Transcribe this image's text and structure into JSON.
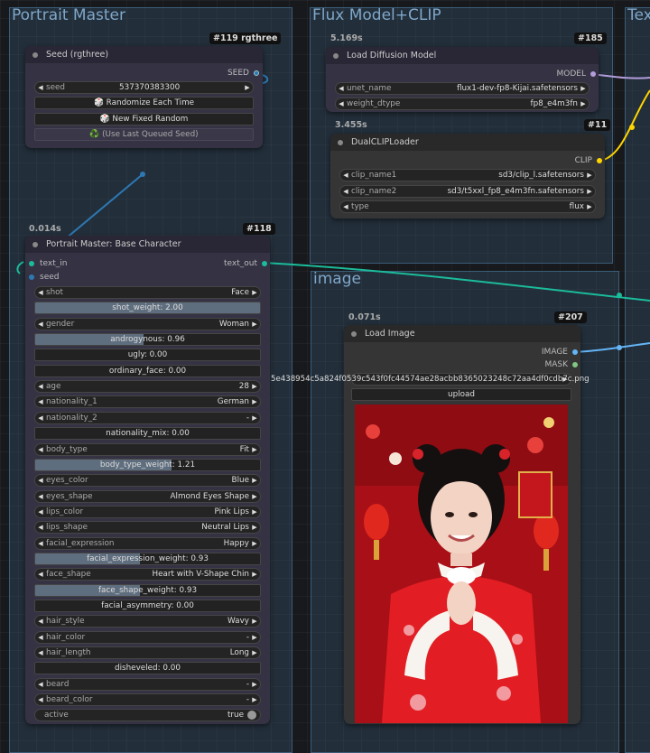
{
  "groups": {
    "portrait_master": "Portrait Master",
    "flux": "Flux Model+CLIP",
    "image": "image",
    "text_partial": "Tex"
  },
  "seed_node": {
    "badge": "#119 rgthree",
    "title": "Seed (rgthree)",
    "output": "SEED",
    "seed_label": "seed",
    "seed_value": "537370383300",
    "btn_randomize": "🎲 Randomize Each Time",
    "btn_new": "🎲 New Fixed Random",
    "btn_last": "♻️ (Use Last Queued Seed)"
  },
  "pm_node": {
    "time": "0.014s",
    "badge": "#118",
    "title": "Portrait Master: Base Character",
    "input_text": "text_in",
    "input_seed": "seed",
    "output": "text_out",
    "rows": [
      {
        "type": "combo",
        "label": "shot",
        "value": "Face"
      },
      {
        "type": "slider",
        "text": "shot_weight: 2.00",
        "fill": 1.0
      },
      {
        "type": "combo",
        "label": "gender",
        "value": "Woman"
      },
      {
        "type": "slider",
        "text": "androgynous: 0.96",
        "fill": 0.48
      },
      {
        "type": "slider",
        "text": "ugly: 0.00",
        "fill": 0
      },
      {
        "type": "slider",
        "text": "ordinary_face: 0.00",
        "fill": 0
      },
      {
        "type": "combo",
        "label": "age",
        "value": "28"
      },
      {
        "type": "combo",
        "label": "nationality_1",
        "value": "German"
      },
      {
        "type": "combo",
        "label": "nationality_2",
        "value": "-"
      },
      {
        "type": "slider",
        "text": "nationality_mix: 0.00",
        "fill": 0
      },
      {
        "type": "combo",
        "label": "body_type",
        "value": "Fit"
      },
      {
        "type": "slider",
        "text": "body_type_weight: 1.21",
        "fill": 0.605
      },
      {
        "type": "combo",
        "label": "eyes_color",
        "value": "Blue"
      },
      {
        "type": "combo",
        "label": "eyes_shape",
        "value": "Almond Eyes Shape"
      },
      {
        "type": "combo",
        "label": "lips_color",
        "value": "Pink Lips"
      },
      {
        "type": "combo",
        "label": "lips_shape",
        "value": "Neutral Lips"
      },
      {
        "type": "combo",
        "label": "facial_expression",
        "value": "Happy"
      },
      {
        "type": "slider",
        "text": "facial_expression_weight: 0.93",
        "fill": 0.465
      },
      {
        "type": "combo",
        "label": "face_shape",
        "value": "Heart with V-Shape Chin"
      },
      {
        "type": "slider",
        "text": "face_shape_weight: 0.93",
        "fill": 0.465
      },
      {
        "type": "slider",
        "text": "facial_asymmetry: 0.00",
        "fill": 0
      },
      {
        "type": "combo",
        "label": "hair_style",
        "value": "Wavy"
      },
      {
        "type": "combo",
        "label": "hair_color",
        "value": "-"
      },
      {
        "type": "combo",
        "label": "hair_length",
        "value": "Long"
      },
      {
        "type": "slider",
        "text": "disheveled: 0.00",
        "fill": 0
      },
      {
        "type": "combo",
        "label": "beard",
        "value": "-"
      },
      {
        "type": "combo",
        "label": "beard_color",
        "value": "-"
      },
      {
        "type": "toggle",
        "label": "active",
        "value": "true"
      }
    ]
  },
  "load_diff": {
    "time": "5.169s",
    "badge": "#185",
    "title": "Load Diffusion Model",
    "output": "MODEL",
    "unet_label": "unet_name",
    "unet_value": "flux1-dev-fp8-Kijai.safetensors",
    "dtype_label": "weight_dtype",
    "dtype_value": "fp8_e4m3fn"
  },
  "dual_clip": {
    "time": "3.455s",
    "badge": "#11",
    "title": "DualCLIPLoader",
    "output": "CLIP",
    "clip1_label": "clip_name1",
    "clip1_value": "sd3/clip_l.safetensors",
    "clip2_label": "clip_name2",
    "clip2_value": "sd3/t5xxl_fp8_e4m3fn.safetensors",
    "type_label": "type",
    "type_value": "flux"
  },
  "load_image": {
    "time": "0.071s",
    "badge": "#207",
    "title": "Load Image",
    "out_image": "IMAGE",
    "out_mask": "MASK",
    "image_value": "5e438954c5a824f0539c543f0fc44574ae28acbb8365023248c72aa4df0cdb7c.png",
    "upload": "upload"
  },
  "colors": {
    "model": "#b39ddb",
    "clip": "#ffd500",
    "string": "#1bbc9b",
    "image": "#64b5f6",
    "mask": "#81c784",
    "seed": "#2d78b3"
  }
}
